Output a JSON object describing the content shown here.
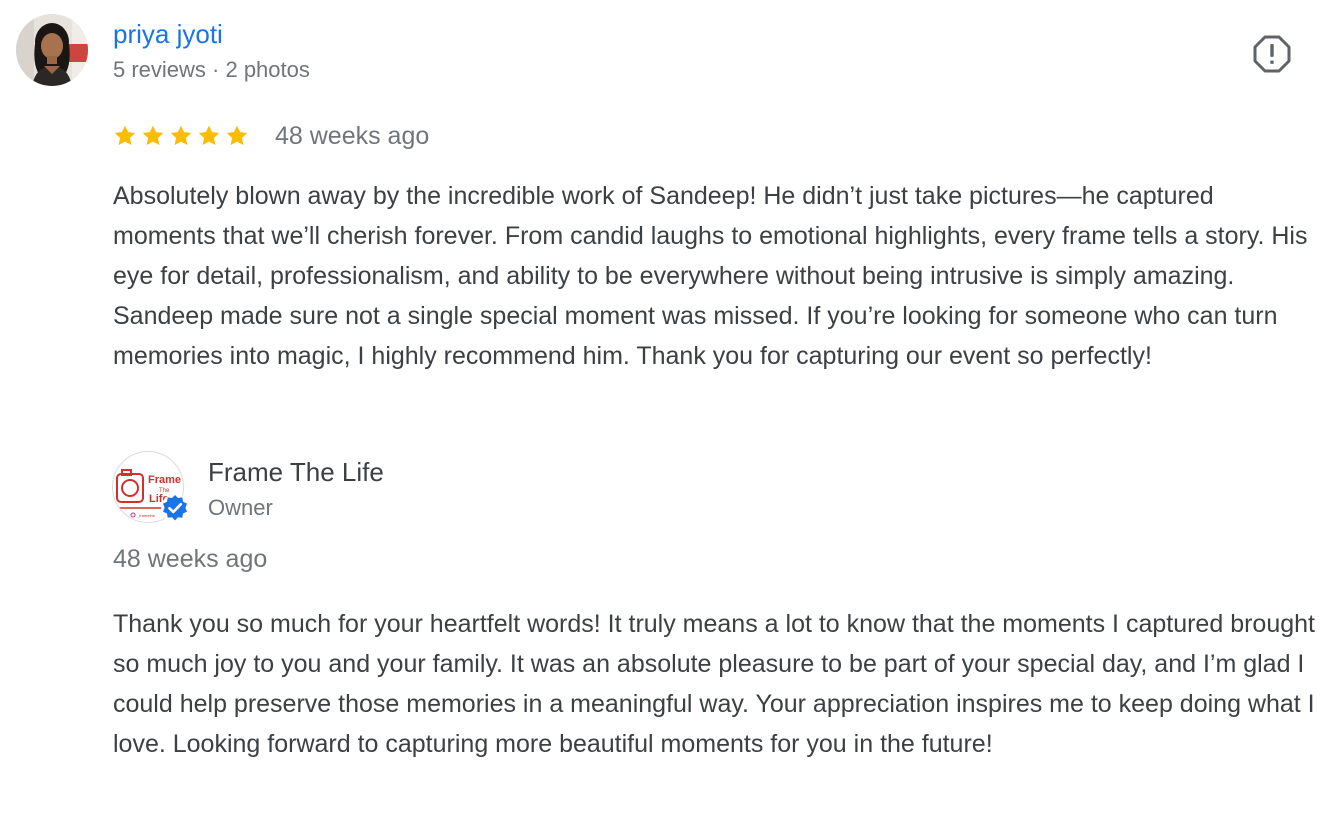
{
  "review": {
    "reviewer": {
      "name": "priya jyoti",
      "meta": "5 reviews · 2 photos",
      "avatar_icon": "profile-photo"
    },
    "rating": 5,
    "max_rating": 5,
    "star_color": "#fbbc04",
    "date": "48 weeks ago",
    "text": "Absolutely blown away by the incredible work of Sandeep! He didn’t just take pictures—he captured moments that we’ll cherish forever. From candid laughs to emotional highlights, every frame tells a story. His eye for detail, professionalism, and ability to be everywhere without being intrusive is simply amazing. Sandeep made sure not a single special moment was missed. If you’re looking for someone who can turn memories into magic, I highly recommend him. Thank you for capturing our event so perfectly!",
    "report_icon": "flag-report-icon"
  },
  "owner_reply": {
    "name": "Frame The Life",
    "role": "Owner",
    "logo": {
      "word1": "Frame",
      "word2": "The",
      "word3": "Life",
      "handle": "_framethe"
    },
    "verified_icon": "verified-badge-icon",
    "verified_color": "#1a73e8",
    "date": "48 weeks ago",
    "text": "Thank you so much for your heartfelt words! It truly means a lot to know that the moments I captured brought so much joy to you and your family. It was an absolute pleasure to be part of your special day, and I’m glad I could help preserve those memories in a meaningful way. Your appreciation inspires me to keep doing what I love. Looking forward to capturing more beautiful moments for you in the future!"
  }
}
